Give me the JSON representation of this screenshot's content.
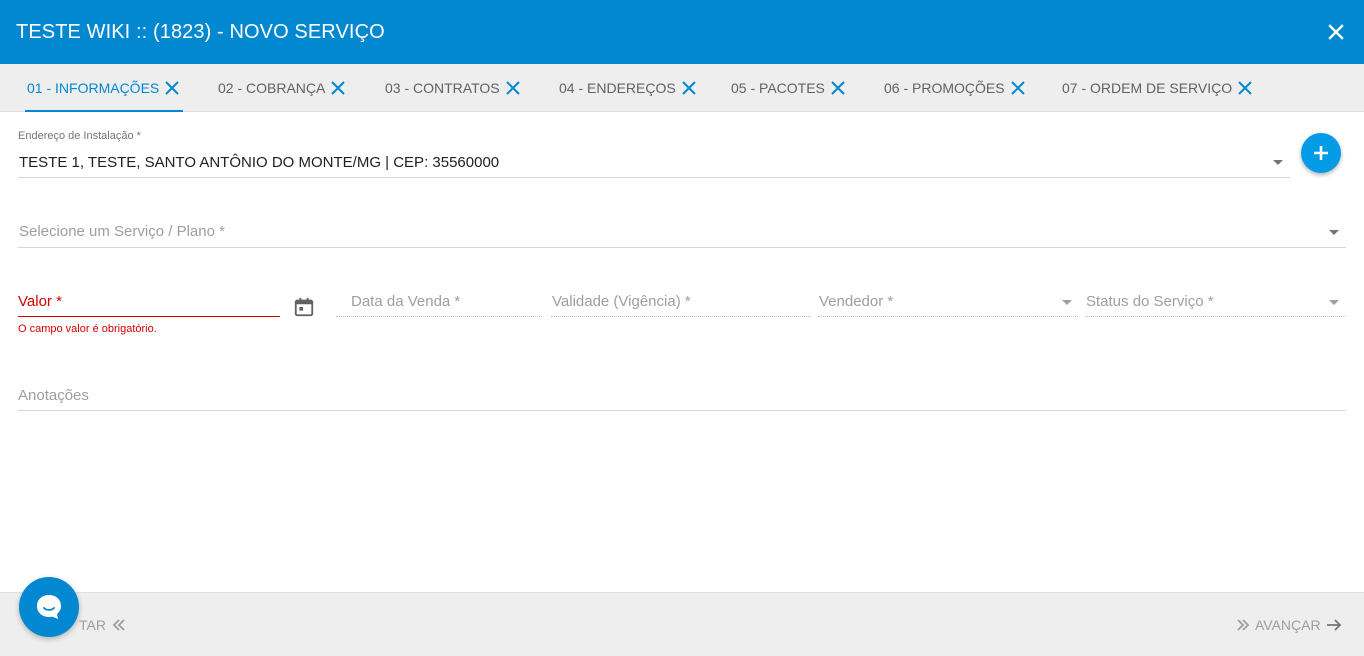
{
  "header": {
    "title": "TESTE WIKI :: (1823) - NOVO SERVIÇO"
  },
  "tabs": [
    {
      "label": "01 - INFORMAÇÕES",
      "active": true
    },
    {
      "label": "02 - COBRANÇA",
      "active": false
    },
    {
      "label": "03 - CONTRATOS",
      "active": false
    },
    {
      "label": "04 - ENDEREÇOS",
      "active": false
    },
    {
      "label": "05 - PACOTES",
      "active": false
    },
    {
      "label": "06 - PROMOÇÕES",
      "active": false
    },
    {
      "label": "07 - ORDEM DE SERVIÇO",
      "active": false
    }
  ],
  "form": {
    "installation_address": {
      "label": "Endereço de Instalação *",
      "value": "TESTE 1, TESTE, SANTO ANTÔNIO DO MONTE/MG | CEP: 35560000"
    },
    "service_plan": {
      "placeholder": "Selecione um Serviço / Plano *"
    },
    "valor": {
      "label": "Valor *",
      "error": "O campo valor é obrigatório."
    },
    "data_venda": {
      "placeholder": "Data da Venda *"
    },
    "validade": {
      "placeholder": "Validade (Vigência) *"
    },
    "vendedor": {
      "placeholder": "Vendedor *"
    },
    "status_servico": {
      "placeholder": "Status do Serviço *"
    },
    "anotacoes": {
      "placeholder": "Anotações"
    }
  },
  "footer": {
    "back_label": "VOLTAR",
    "back_visible_label": "TAR",
    "next_label": "AVANÇAR"
  },
  "colors": {
    "primary": "#0288d1",
    "error": "#d50000",
    "fab": "#039be5"
  },
  "icons": {
    "close": "close-icon",
    "tab_close": "close-icon",
    "calendar": "calendar-icon",
    "add": "plus-icon",
    "chat": "chat-bubble-icon",
    "back": "double-chevron-left-icon",
    "next": "arrow-right-icon"
  }
}
